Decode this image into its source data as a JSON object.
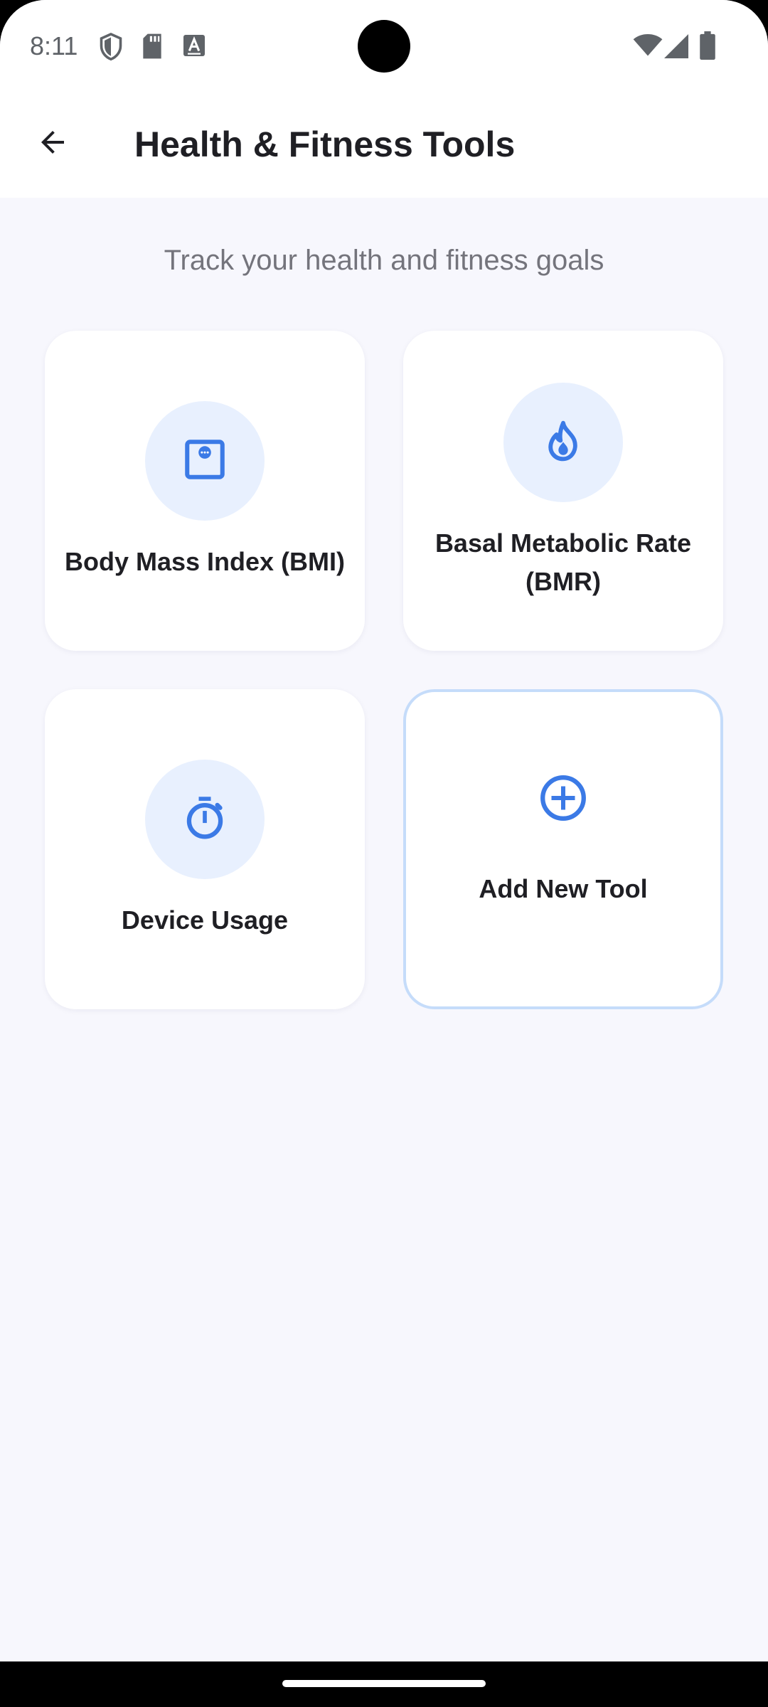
{
  "status_bar": {
    "time": "8:11",
    "icons": [
      "shield-icon",
      "sd-card-icon",
      "keyboard-a-icon",
      "wifi-icon",
      "signal-icon",
      "battery-icon"
    ]
  },
  "app_bar": {
    "title": "Health & Fitness Tools",
    "back_icon": "arrow-left-icon"
  },
  "content": {
    "subtitle": "Track your health and fitness goals",
    "tools": [
      {
        "label": "Body Mass Index (BMI)",
        "icon": "scale-icon"
      },
      {
        "label": "Basal Metabolic Rate (BMR)",
        "icon": "fire-icon"
      },
      {
        "label": "Device Usage",
        "icon": "timer-icon"
      },
      {
        "label": "Add New Tool",
        "icon": "add-circle-icon"
      }
    ]
  },
  "colors": {
    "accent": "#3b7ae6",
    "icon_bg": "#e8f0fe",
    "page_bg": "#f7f7fd",
    "card_bg": "#ffffff",
    "add_border": "#c5dcfa",
    "title": "#1f1f24",
    "subtitle": "#74747c"
  }
}
